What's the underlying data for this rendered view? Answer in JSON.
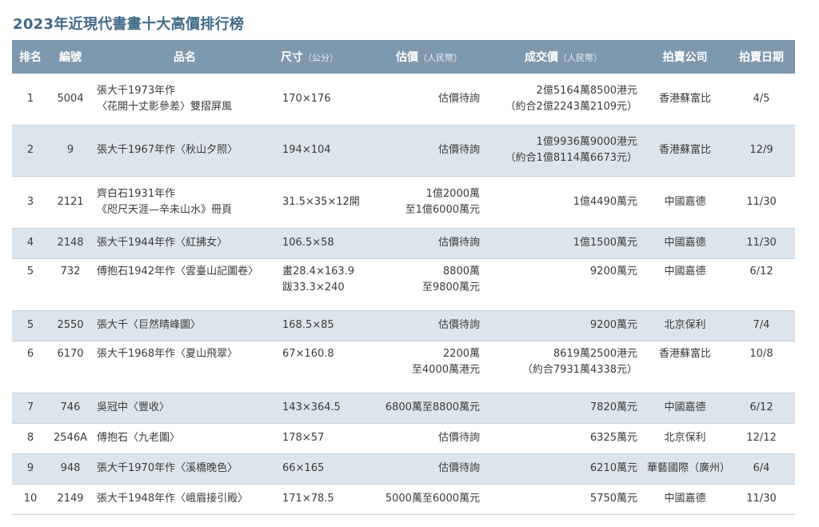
{
  "title": "2023年近現代書畫十大高價排行榜",
  "headers": {
    "rank": "排名",
    "lot": "編號",
    "name": "品名",
    "size": "尺寸",
    "size_unit": "（公分）",
    "estimate": "估價",
    "estimate_unit": "（人民幣）",
    "price": "成交價",
    "price_unit": "（人民幣）",
    "house": "拍賣公司",
    "date": "拍賣日期"
  },
  "rows": [
    {
      "rank": "1",
      "lot": "5004",
      "name1": "張大千1973年作",
      "name2": "〈花開十丈影參差〉雙摺屏風",
      "size1": "170×176",
      "size2": "",
      "est1": "估價待詢",
      "est2": "",
      "price1": "2億5164萬8500港元",
      "price2": "（約合2億2243萬2109元）",
      "house": "香港蘇富比",
      "date": "4/5"
    },
    {
      "rank": "2",
      "lot": "9",
      "name1": "張大千1967年作〈秋山夕照〉",
      "name2": "",
      "size1": "194×104",
      "size2": "",
      "est1": "估價待詢",
      "est2": "",
      "price1": "1億9936萬9000港元",
      "price2": "（約合1億8114萬6673元）",
      "house": "香港蘇富比",
      "date": "12/9"
    },
    {
      "rank": "3",
      "lot": "2121",
      "name1": "齊白石1931年作",
      "name2": "《咫尺天涯—辛未山水》冊頁",
      "size1": "31.5×35×12開",
      "size2": "",
      "est1": "1億2000萬",
      "est2": "至1億6000萬元",
      "price1": "1億4490萬元",
      "price2": "",
      "house": "中國嘉德",
      "date": "11/30"
    },
    {
      "rank": "4",
      "lot": "2148",
      "name1": "張大千1944年作〈紅拂女〉",
      "name2": "",
      "size1": "106.5×58",
      "size2": "",
      "est1": "估價待詢",
      "est2": "",
      "price1": "1億1500萬元",
      "price2": "",
      "house": "中國嘉德",
      "date": "11/30"
    },
    {
      "rank": "5",
      "lot": "732",
      "name1": "傅抱石1942年作〈雲臺山記圖卷〉",
      "name2": "",
      "size1": "畫28.4×163.9",
      "size2": "跋33.3×240",
      "est1": "8800萬",
      "est2": "至9800萬元",
      "price1": "9200萬元",
      "price2": "",
      "house": "中國嘉德",
      "date": "6/12"
    },
    {
      "rank": "5",
      "lot": "2550",
      "name1": "張大千〈巨然晴峰圖〉",
      "name2": "",
      "size1": "168.5×85",
      "size2": "",
      "est1": "估價待詢",
      "est2": "",
      "price1": "9200萬元",
      "price2": "",
      "house": "北京保利",
      "date": "7/4"
    },
    {
      "rank": "6",
      "lot": "6170",
      "name1": "張大千1968年作〈夏山飛翠〉",
      "name2": "",
      "size1": "67×160.8",
      "size2": "",
      "est1": "2200萬",
      "est2": "至4000萬港元",
      "price1": "8619萬2500港元",
      "price2": "（約合7931萬4338元）",
      "house": "香港蘇富比",
      "date": "10/8"
    },
    {
      "rank": "7",
      "lot": "746",
      "name1": "吳冠中〈豐收〉",
      "name2": "",
      "size1": "143×364.5",
      "size2": "",
      "est1": "6800萬至8800萬元",
      "est2": "",
      "price1": "7820萬元",
      "price2": "",
      "house": "中國嘉德",
      "date": "6/12"
    },
    {
      "rank": "8",
      "lot": "2546A",
      "name1": "傅抱石〈九老圖〉",
      "name2": "",
      "size1": "178×57",
      "size2": "",
      "est1": "估價待詢",
      "est2": "",
      "price1": "6325萬元",
      "price2": "",
      "house": "北京保利",
      "date": "12/12"
    },
    {
      "rank": "9",
      "lot": "948",
      "name1": "張大千1970年作〈溪橋晚色〉",
      "name2": "",
      "size1": "66×165",
      "size2": "",
      "est1": "估價待詢",
      "est2": "",
      "price1": "6210萬元",
      "price2": "",
      "house": "華藝國際（廣州）",
      "date": "6/4"
    },
    {
      "rank": "10",
      "lot": "2149",
      "name1": "張大千1948年作〈峨眉接引殿〉",
      "name2": "",
      "size1": "171×78.5",
      "size2": "",
      "est1": "5000萬至6000萬元",
      "est2": "",
      "price1": "5750萬元",
      "price2": "",
      "house": "中國嘉德",
      "date": "11/30"
    }
  ]
}
